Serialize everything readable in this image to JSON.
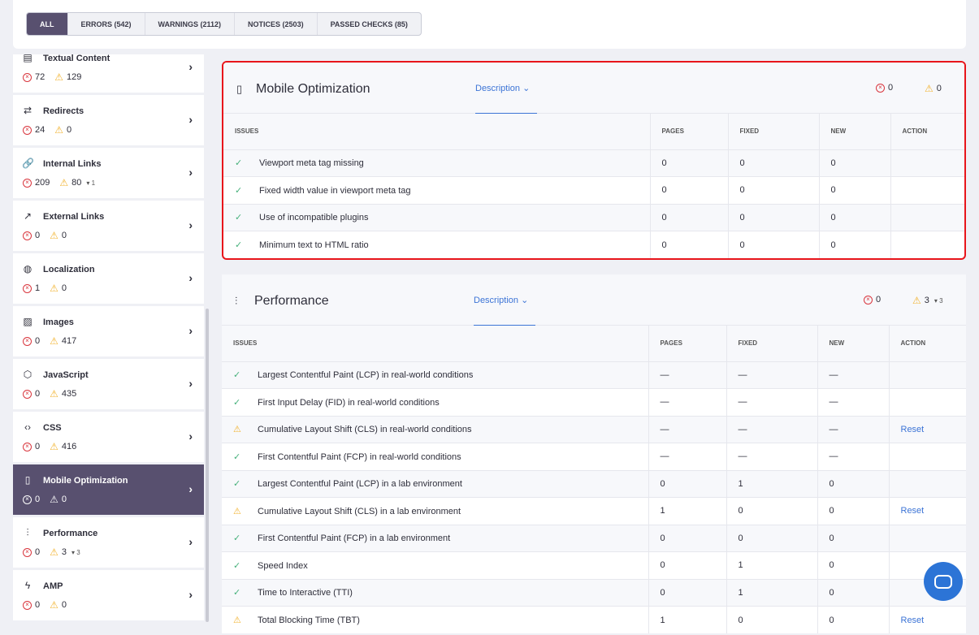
{
  "filters": [
    {
      "label": "ALL",
      "active": true
    },
    {
      "label": "ERRORS (542)"
    },
    {
      "label": "WARNINGS (2112)"
    },
    {
      "label": "NOTICES (2503)"
    },
    {
      "label": "PASSED CHECKS (85)"
    }
  ],
  "sidebar": {
    "items": [
      {
        "name": "Textual Content",
        "icon": "doc-icon",
        "errors": "72",
        "warnings": "129",
        "delta": ""
      },
      {
        "name": "Redirects",
        "icon": "redirect-icon",
        "errors": "24",
        "warnings": "0",
        "delta": ""
      },
      {
        "name": "Internal Links",
        "icon": "link-icon",
        "errors": "209",
        "warnings": "80",
        "delta": "▾ 1"
      },
      {
        "name": "External Links",
        "icon": "external-link-icon",
        "errors": "0",
        "warnings": "0",
        "delta": ""
      },
      {
        "name": "Localization",
        "icon": "globe-icon",
        "errors": "1",
        "warnings": "0",
        "delta": ""
      },
      {
        "name": "Images",
        "icon": "image-icon",
        "errors": "0",
        "warnings": "417",
        "delta": ""
      },
      {
        "name": "JavaScript",
        "icon": "cube-icon",
        "errors": "0",
        "warnings": "435",
        "delta": ""
      },
      {
        "name": "CSS",
        "icon": "code-icon",
        "errors": "0",
        "warnings": "416",
        "delta": ""
      },
      {
        "name": "Mobile Optimization",
        "icon": "mobile-icon",
        "errors": "0",
        "warnings": "0",
        "delta": "",
        "active": true
      },
      {
        "name": "Performance",
        "icon": "sliders-icon",
        "errors": "0",
        "warnings": "3",
        "delta": "▾ 3"
      },
      {
        "name": "AMP",
        "icon": "bolt-icon",
        "errors": "0",
        "warnings": "0",
        "delta": ""
      }
    ]
  },
  "columns": [
    "ISSUES",
    "PAGES",
    "FIXED",
    "NEW",
    "ACTION"
  ],
  "sections": [
    {
      "title": "Mobile Optimization",
      "icon": "mobile-icon",
      "description": "Description",
      "errors": "0",
      "warnings": "0",
      "delta": "",
      "rows": [
        {
          "status": "passed",
          "issue": "Viewport meta tag missing",
          "pages": "0",
          "fixed": "0",
          "new": "0",
          "action": ""
        },
        {
          "status": "passed",
          "issue": "Fixed width value in viewport meta tag",
          "pages": "0",
          "fixed": "0",
          "new": "0",
          "action": ""
        },
        {
          "status": "passed",
          "issue": "Use of incompatible plugins",
          "pages": "0",
          "fixed": "0",
          "new": "0",
          "action": ""
        },
        {
          "status": "passed",
          "issue": "Minimum text to HTML ratio",
          "pages": "0",
          "fixed": "0",
          "new": "0",
          "action": ""
        }
      ]
    },
    {
      "title": "Performance",
      "icon": "sliders-icon",
      "description": "Description",
      "errors": "0",
      "warnings": "3",
      "delta": "▾ 3",
      "rows": [
        {
          "status": "passed",
          "issue": "Largest Contentful Paint (LCP) in real-world conditions",
          "pages": "—",
          "fixed": "—",
          "new": "—",
          "action": ""
        },
        {
          "status": "passed",
          "issue": "First Input Delay (FID) in real-world conditions",
          "pages": "—",
          "fixed": "—",
          "new": "—",
          "action": ""
        },
        {
          "status": "warning",
          "issue": "Cumulative Layout Shift (CLS) in real-world conditions",
          "pages": "—",
          "fixed": "—",
          "new": "—",
          "action": "Reset"
        },
        {
          "status": "passed",
          "issue": "First Contentful Paint (FCP) in real-world conditions",
          "pages": "—",
          "fixed": "—",
          "new": "—",
          "action": ""
        },
        {
          "status": "passed",
          "issue": "Largest Contentful Paint (LCP) in a lab environment",
          "pages": "0",
          "fixed": "1",
          "new": "0",
          "action": ""
        },
        {
          "status": "warning",
          "issue": "Cumulative Layout Shift (CLS) in a lab environment",
          "pages": "1",
          "fixed": "0",
          "new": "0",
          "action": "Reset"
        },
        {
          "status": "passed",
          "issue": "First Contentful Paint (FCP) in a lab environment",
          "pages": "0",
          "fixed": "0",
          "new": "0",
          "action": ""
        },
        {
          "status": "passed",
          "issue": "Speed Index",
          "pages": "0",
          "fixed": "1",
          "new": "0",
          "action": ""
        },
        {
          "status": "passed",
          "issue": "Time to Interactive (TTI)",
          "pages": "0",
          "fixed": "1",
          "new": "0",
          "action": ""
        },
        {
          "status": "warning",
          "issue": "Total Blocking Time (TBT)",
          "pages": "1",
          "fixed": "0",
          "new": "0",
          "action": "Reset"
        }
      ]
    }
  ],
  "colors": {
    "accent": "#58506f",
    "error": "#d9363e",
    "warning": "#f2b330",
    "passed": "#46b17b",
    "link": "#3c74d6",
    "highlight": "#e8151b"
  }
}
